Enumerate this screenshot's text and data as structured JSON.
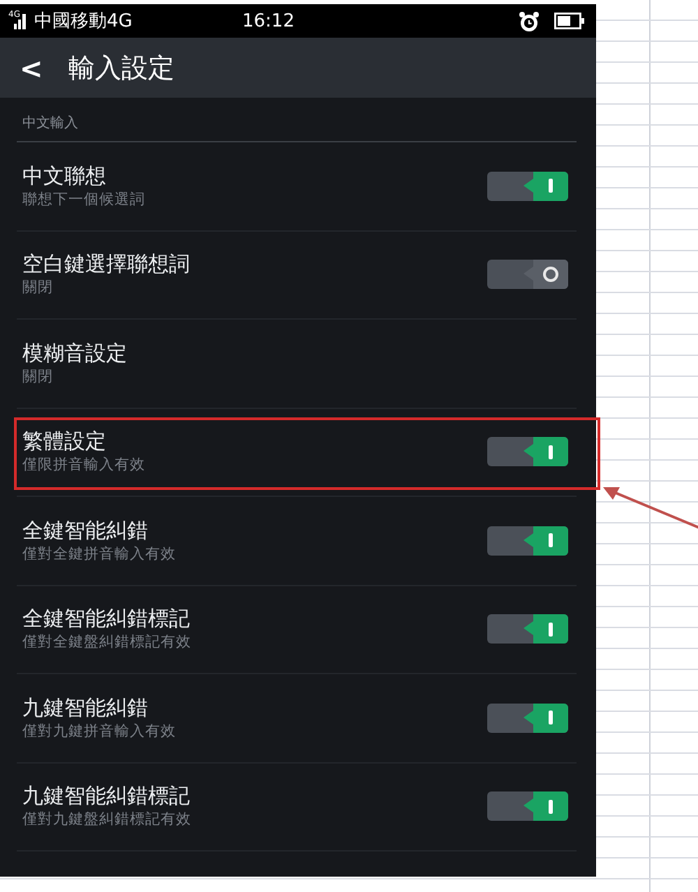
{
  "status_bar": {
    "network": "4G",
    "carrier": "中國移動4G",
    "time": "16:12"
  },
  "header": {
    "back": "<",
    "title": "輸入設定"
  },
  "section": {
    "label": "中文輸入"
  },
  "settings": [
    {
      "title": "中文聯想",
      "subtitle": "聯想下一個候選詞",
      "kind": "toggle",
      "on": true,
      "highlighted": false
    },
    {
      "title": "空白鍵選擇聯想詞",
      "subtitle": "關閉",
      "kind": "toggle",
      "on": false,
      "highlighted": false
    },
    {
      "title": "模糊音設定",
      "subtitle": "關閉",
      "kind": "link",
      "highlighted": false
    },
    {
      "title": "繁體設定",
      "subtitle": "僅限拼音輸入有效",
      "kind": "toggle",
      "on": true,
      "highlighted": true
    },
    {
      "title": "全鍵智能糾錯",
      "subtitle": "僅對全鍵拼音輸入有效",
      "kind": "toggle",
      "on": true,
      "highlighted": false
    },
    {
      "title": "全鍵智能糾錯標記",
      "subtitle": "僅對全鍵盤糾錯標記有效",
      "kind": "toggle",
      "on": true,
      "highlighted": false
    },
    {
      "title": "九鍵智能糾錯",
      "subtitle": "僅對九鍵拼音輸入有效",
      "kind": "toggle",
      "on": true,
      "highlighted": false
    },
    {
      "title": "九鍵智能糾錯標記",
      "subtitle": "僅對九鍵盤糾錯標記有效",
      "kind": "toggle",
      "on": true,
      "highlighted": false
    }
  ]
}
